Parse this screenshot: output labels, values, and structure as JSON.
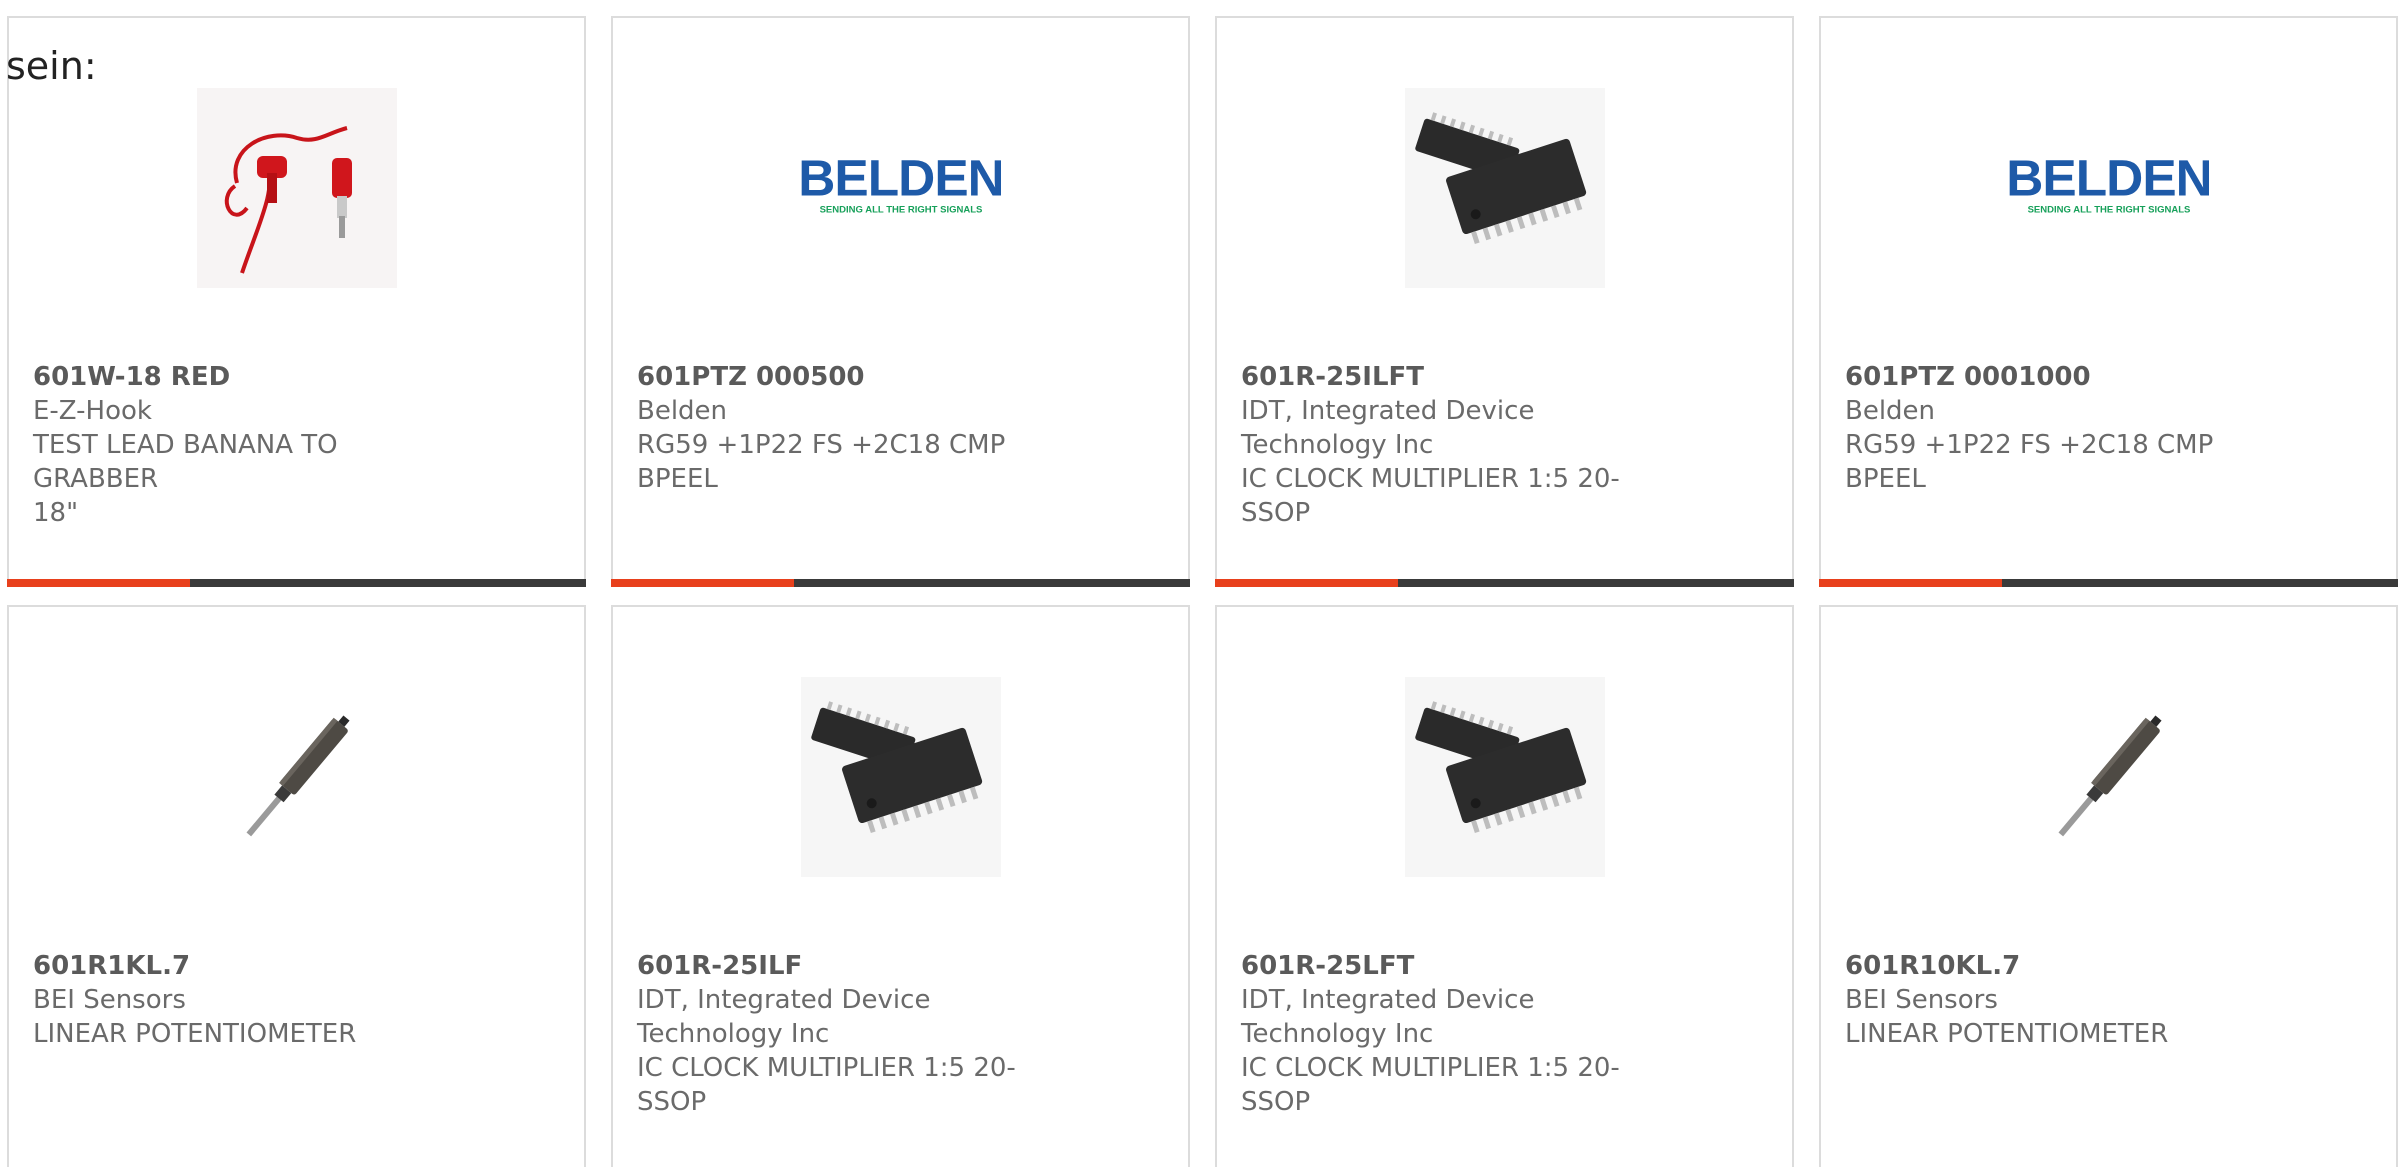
{
  "header": {
    "text": "sein:"
  },
  "colors": {
    "accent": "#e8401c",
    "bar": "#3a3a3a",
    "brand_blue": "#1e5aa8",
    "brand_green": "#17a05a"
  },
  "cards": [
    {
      "part_number": "601W-18 RED",
      "manufacturer": "E-Z-Hook",
      "desc_lines": [
        "TEST LEAD BANANA TO GRABBER",
        "18\""
      ],
      "image": "test-lead-image"
    },
    {
      "part_number": "601PTZ 000500",
      "manufacturer": "Belden",
      "desc_lines": [
        "RG59 +1P22 FS +2C18 CMP",
        "BPEEL"
      ],
      "image": "belden-logo",
      "logo_text": "BELDEN",
      "logo_tagline": "SENDING ALL THE RIGHT SIGNALS"
    },
    {
      "part_number": "601R-25ILFT",
      "manufacturer_lines": [
        "IDT, Integrated Device",
        "Technology Inc"
      ],
      "desc_lines": [
        "IC CLOCK MULTIPLIER 1:5 20-",
        "SSOP"
      ],
      "image": "ic-chip-image"
    },
    {
      "part_number": "601PTZ 0001000",
      "manufacturer": "Belden",
      "desc_lines": [
        "RG59 +1P22 FS +2C18 CMP",
        "BPEEL"
      ],
      "image": "belden-logo",
      "logo_text": "BELDEN",
      "logo_tagline": "SENDING ALL THE RIGHT SIGNALS"
    },
    {
      "part_number": "601R1KL.7",
      "manufacturer": "BEI Sensors",
      "desc_lines": [
        "LINEAR POTENTIOMETER"
      ],
      "image": "potentiometer-image"
    },
    {
      "part_number": "601R-25ILF",
      "manufacturer_lines": [
        "IDT, Integrated Device",
        "Technology Inc"
      ],
      "desc_lines": [
        "IC CLOCK MULTIPLIER 1:5 20-",
        "SSOP"
      ],
      "image": "ic-chip-image"
    },
    {
      "part_number": "601R-25LFT",
      "manufacturer_lines": [
        "IDT, Integrated Device",
        "Technology Inc"
      ],
      "desc_lines": [
        "IC CLOCK MULTIPLIER 1:5 20-",
        "SSOP"
      ],
      "image": "ic-chip-image"
    },
    {
      "part_number": "601R10KL.7",
      "manufacturer": "BEI Sensors",
      "desc_lines": [
        "LINEAR POTENTIOMETER"
      ],
      "image": "potentiometer-image"
    }
  ]
}
